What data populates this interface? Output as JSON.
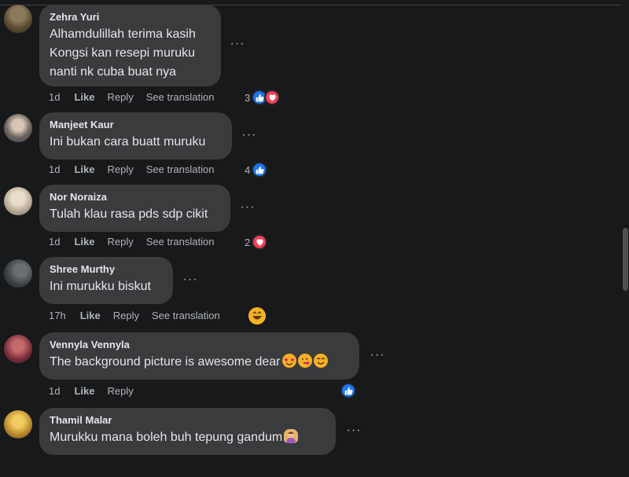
{
  "comments": [
    {
      "author": "Zehra Yuri",
      "text": "Alhamdulillah terima kasih\nKongsi kan resepi muruku\nnanti nk cuba buat nya",
      "time": "1d",
      "like_label": "Like",
      "reply_label": "Reply",
      "translate_label": "See translation",
      "reaction_count": "3",
      "reactions": [
        "like",
        "love"
      ]
    },
    {
      "author": "Manjeet Kaur",
      "text": "Ini bukan cara buatt muruku",
      "time": "1d",
      "like_label": "Like",
      "reply_label": "Reply",
      "translate_label": "See translation",
      "reaction_count": "4",
      "reactions": [
        "like"
      ]
    },
    {
      "author": "Nor Noraiza",
      "text": "Tulah klau rasa pds sdp cikit",
      "time": "1d",
      "like_label": "Like",
      "reply_label": "Reply",
      "translate_label": "See translation",
      "reaction_count": "2",
      "reactions": [
        "love"
      ]
    },
    {
      "author": "Shree Murthy",
      "text": "Ini murukku biskut",
      "time": "17h",
      "like_label": "Like",
      "reply_label": "Reply",
      "translate_label": "See translation",
      "reaction_count": "",
      "reactions": [
        "laugh"
      ]
    },
    {
      "author": "Vennyla Vennyla",
      "text": "The background picture is awesome dear",
      "time": "1d",
      "like_label": "Like",
      "reply_label": "Reply",
      "reaction_count": "",
      "reactions": [
        "like"
      ],
      "inline_emojis": [
        "star-struck-emoji",
        "kissing-heart-emoji",
        "smiling-emoji"
      ]
    },
    {
      "author": "Thamil Malar",
      "text": "Murukku mana boleh buh tepung gandum",
      "inline_emojis": [
        "person-facepalming-emoji"
      ]
    }
  ],
  "more_glyph": "···",
  "colors": {
    "background": "#18191a",
    "bubble": "#3a3b3c",
    "text": "#e4e6eb",
    "secondary_text": "#b0b3b8",
    "like_blue": "#1877f2",
    "love_red": "#f33e58",
    "emoji_yellow": "#f7b125"
  }
}
